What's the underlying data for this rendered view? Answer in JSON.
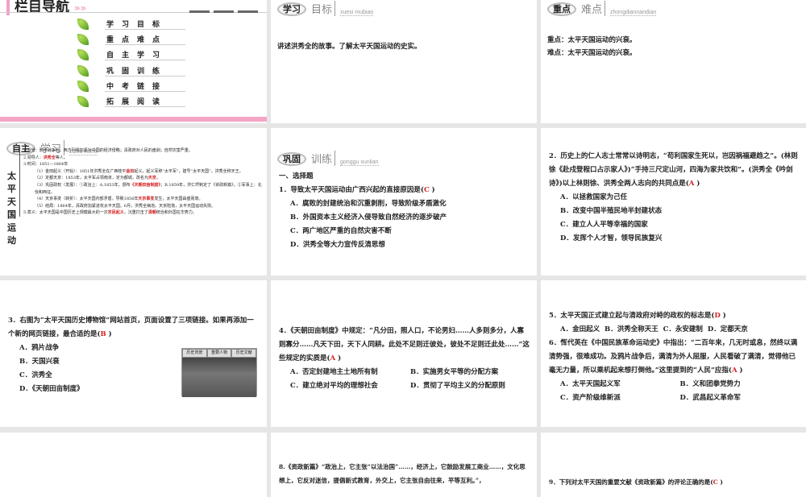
{
  "nav": {
    "title": "栏目导航",
    "items": [
      "学习目标",
      "重点难点",
      "自主学习",
      "巩固训练",
      "中考链接",
      "拓展阅读"
    ]
  },
  "goals": {
    "badge": "学习",
    "sub": "目标",
    "pinyin": "xuexi mubiao",
    "text": "讲述洪秀全的故事。了解太平天国运动的史实。"
  },
  "focus": {
    "badge": "重点",
    "sub": "难点",
    "pinyin": "zhongdiannandian",
    "key": "重点：太平天国运动的兴衰。",
    "hard": "难点：太平天国运动的兴衰。"
  },
  "self": {
    "badge": "自主",
    "sub": "学习",
    "pinyin": "zizhu xuexi",
    "vertical": "太平天国运动",
    "lines": [
      {
        "t": "1.背景：鸦片战争后，西方列强加紧对中国的经济侵略；清政府对人民的盘剥；自然灾害严重。",
        "lv": 0
      },
      {
        "t": "2.领导人：",
        "a": "洪秀全",
        "t2": "等人。",
        "lv": 0
      },
      {
        "t": "3.时间：1851—1864年",
        "lv": 0
      },
      {
        "t": "（1）金田起义（开始）：1851年洪秀全在广西桂平",
        "a": "金田",
        "t2": "起义，起义军称“太平军”，建号“太平天国”，洪秀全称天王。",
        "lv": 1
      },
      {
        "t": "（2）定都天京：1853年，太平军占领南京，定为都城，改名为",
        "a": "天京",
        "t2": "。",
        "lv": 1
      },
      {
        "t": "（3）巩固政权（发展）：①政治上：A.1853年，颁布",
        "a": "《天朝田亩制度》",
        "t2": "；B.1859年，洪仁玕制定了《资政新篇》。②军事上：北伐和西征。",
        "lv": 1
      },
      {
        "t": "（4）天京事变（转折）：太平天国内部矛盾，导致1856年",
        "a": "天京事变",
        "t2": "发生，太平天国由盛而衰。",
        "lv": 1
      },
      {
        "t": "（5）结局：1864年，清政府加紧进攻太平天国。6月，洪秀全病逝。天京陷落，太平天国运动失败。",
        "lv": 1
      },
      {
        "t": "5.意义：太平天国是中国历史上规模最大的一次",
        "a": "农民起义",
        "t2": "，沉重打击了",
        "a2": "清朝",
        "t3": "统治和外国在华势力。",
        "lv": 0
      }
    ]
  },
  "train": {
    "badge": "巩固",
    "sub": "训练",
    "pinyin": "gonggu xunlian",
    "section": "一、选择题"
  },
  "questions": [
    {
      "stem": "1．导致太平天国运动由广西兴起的直接原因是(",
      "ans": "C",
      "opts": [
        "A．腐败的封建统治和沉重剥削，导致阶级矛盾激化",
        "B．外国资本主义经济入侵导致自然经济的逐步破产",
        "C．两广地区严重的自然灾害不断",
        "D．洪秀全等大力宣传反清思想"
      ]
    },
    {
      "stem": "2．历史上的仁人志士常常以诗明志，“苟利国家生死以，岂因祸福避趋之”。(林则徐《赴戍登程口占示家人》)“手持三尺定山河，四海为家共饮和”。(洪秀全《吟剑诗》)以上林则徐、洪秀全两人志向的共同点是(",
      "ans": "A",
      "opts": [
        "A．以拯救国家为己任",
        "B．改变中国半殖民地半封建状态",
        "C．建立人人平等幸福的国家",
        "D．发挥个人才智，领导民族复兴"
      ]
    },
    {
      "stem": "3．右图为“太平天国历史博物馆”网站首页，页面设置了三项链接。如果再添加一个新的网页链接，最合适的是(",
      "ans": "B",
      "opts": [
        "A．鸦片战争",
        "B．天国兴衰",
        "C．洪秀全",
        "D．《天朝田亩制度》"
      ],
      "tabs": [
        "历史背景",
        "重要人物",
        "历史文献"
      ]
    },
    {
      "stem": "4．《天朝田亩制度》中规定：“凡分田，照人口，不论男妇……人多则多分，人寡则寡分……凡天下田，天下人同耕。此处不足则迁彼处，彼处不足则迁此处……”这些规定的实质是(",
      "ans": "A",
      "opts": [
        "A．否定封建地主土地所有制",
        "B．实施男女平等的分配方案",
        "C．建立绝对平均的理想社会",
        "D．贯彻了平均主义的分配原则"
      ]
    },
    {
      "stem": "5．太平天国正式建立起与清政府对峙的政权的标志是(",
      "ans": "D",
      "opts": [
        "A．金田起义",
        "B．洪秀全称天王",
        "C．永安建制",
        "D．定都天京"
      ]
    },
    {
      "stem": "6．恽代英在《中国民族革命运动史》中指出：“二百年来，几无时或息，然终以满清势强，很难成功。及鸦片战争后，满清为外人屈服，人民看破了满清，觉得他已毫无力量，所以乘机起来想打倒他。”这里提到的“人民”应指(",
      "ans": "A",
      "opts": [
        "A．太平天国起义军",
        "B．义和团拳党势力",
        "C．资产阶级维新派",
        "D．武昌起义革命军"
      ]
    },
    {
      "stem": "8.《资政新篇》“政治上，它主张“以法治国”……，经济上，它鼓励发展工商业……，文化思想上，它反对迷信，提倡新式教育，外交上，它主张自由往来，平等互利。”，"
    },
    {
      "stem": "9．下列对太平天国的重要文献《资政新篇》的评论正确的是(",
      "ans": "C"
    }
  ]
}
